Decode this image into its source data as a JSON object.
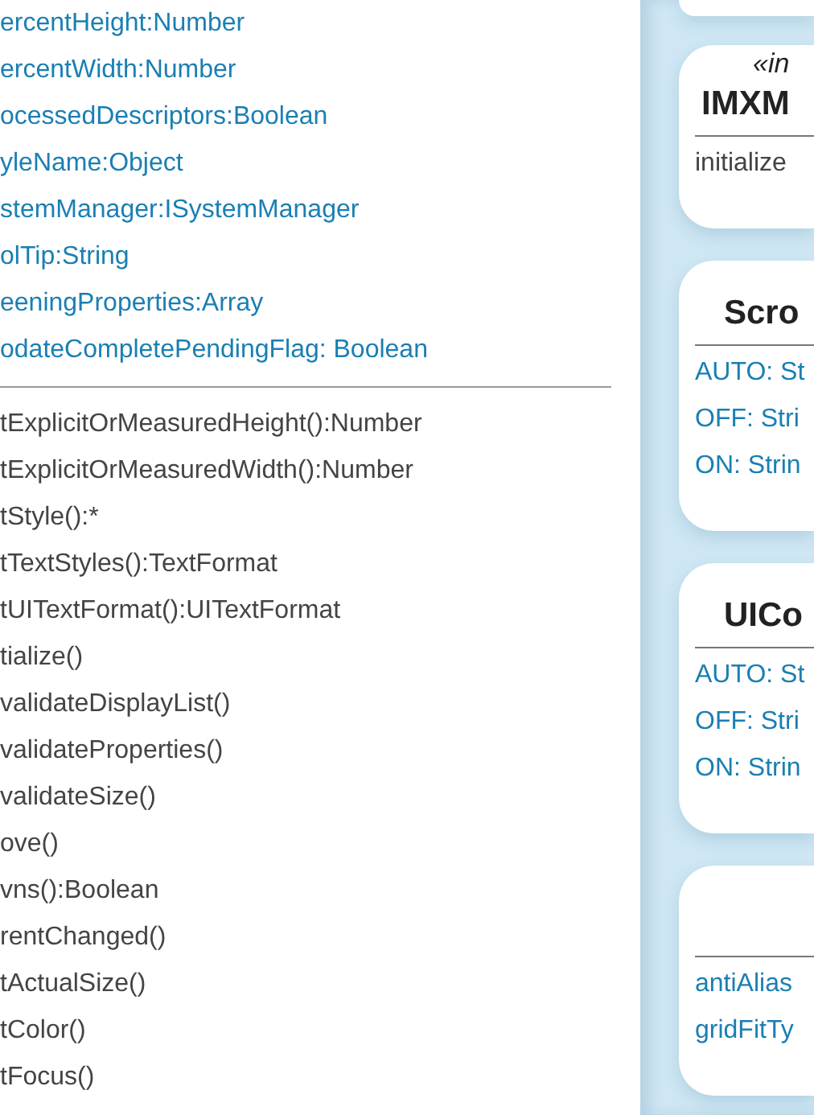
{
  "main_class": {
    "attributes": [
      "ercentHeight:Number",
      "ercentWidth:Number",
      "ocessedDescriptors:Boolean",
      "yleName:Object",
      "stemManager:ISystemManager",
      "olTip:String",
      "eeningProperties:Array",
      "odateCompletePendingFlag: Boolean"
    ],
    "methods": [
      "tExplicitOrMeasuredHeight():Number",
      "tExplicitOrMeasuredWidth():Number",
      "tStyle():*",
      "tTextStyles():TextFormat",
      "tUITextFormat():UITextFormat",
      "tialize()",
      "validateDisplayList()",
      "validateProperties()",
      "validateSize()",
      "ove()",
      "vns():Boolean",
      "rentChanged()",
      "tActualSize()",
      "tColor()",
      "tFocus()"
    ]
  },
  "side_classes": [
    {
      "stereotype": "«in",
      "name": "IMXM",
      "methods": [
        "initialize"
      ]
    },
    {
      "name": "Scro",
      "attributes": [
        "AUTO: St",
        "OFF: Stri",
        "ON: Strin"
      ]
    },
    {
      "name": "UICo",
      "attributes": [
        "AUTO: St",
        "OFF: Stri",
        "ON: Strin"
      ]
    },
    {
      "attributes": [
        "antiAlias",
        "gridFitTy"
      ]
    }
  ]
}
